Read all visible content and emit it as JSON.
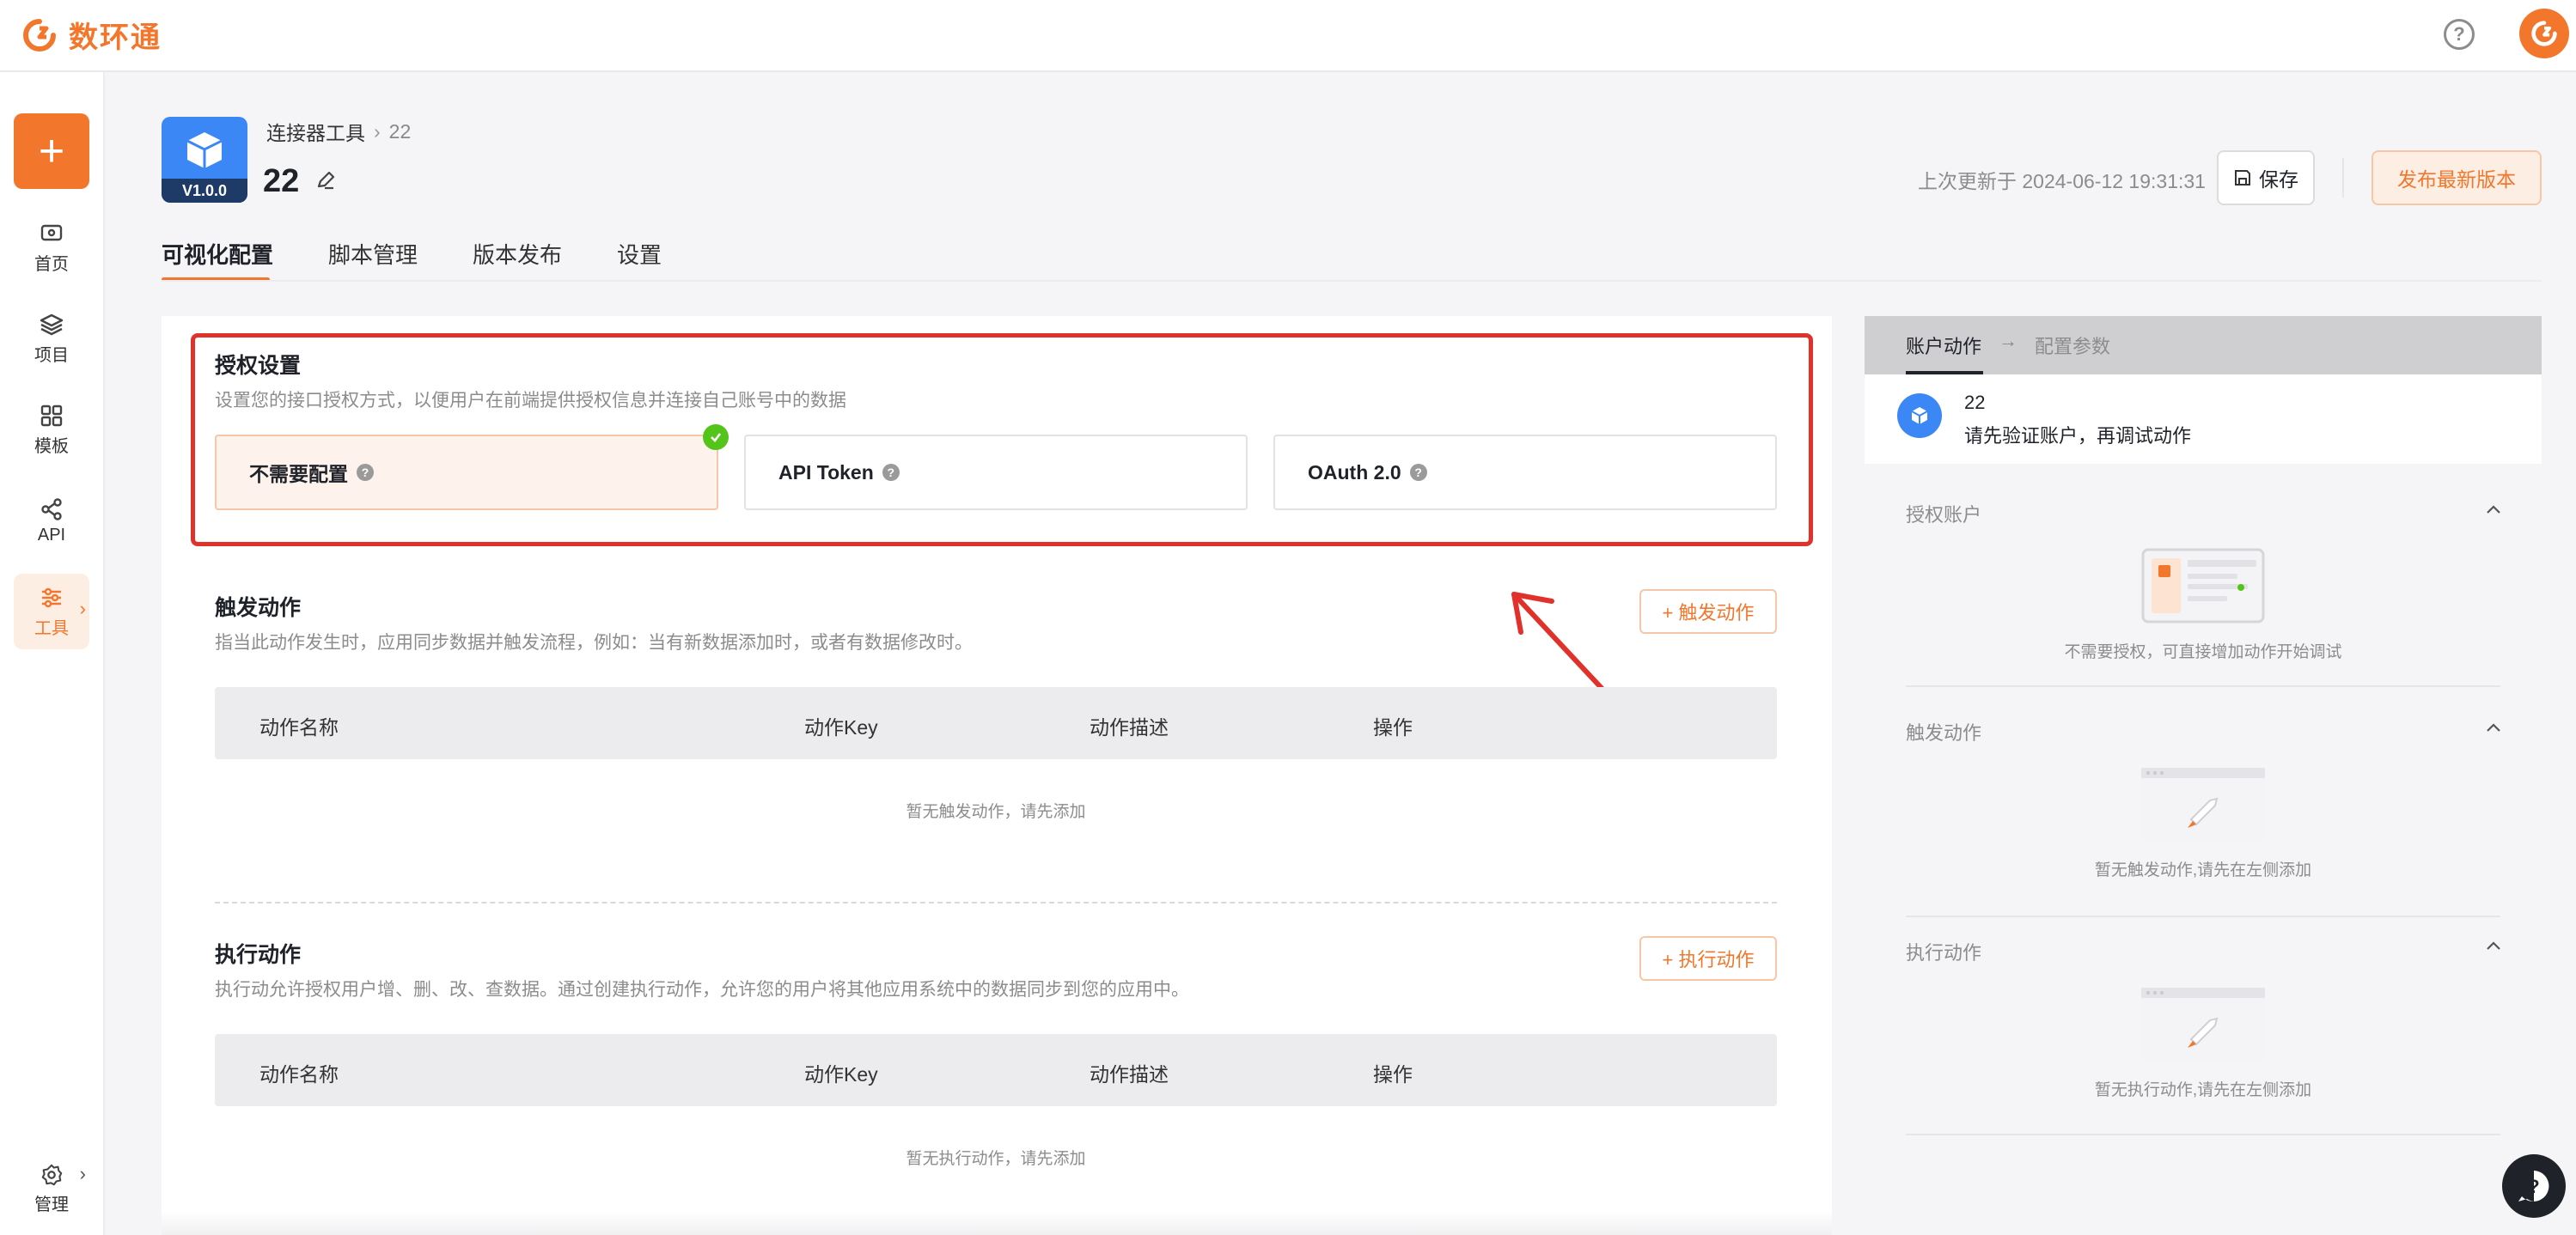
{
  "brand": {
    "name": "数环通",
    "accent": "#f2772c"
  },
  "leftnav": {
    "add_label": "+",
    "items": [
      {
        "label": "首页",
        "icon": "home-icon"
      },
      {
        "label": "项目",
        "icon": "layers-icon"
      },
      {
        "label": "模板",
        "icon": "grid-icon"
      },
      {
        "label": "API",
        "icon": "api-icon"
      },
      {
        "label": "工具",
        "icon": "tools-icon",
        "active": true
      }
    ],
    "manage_label": "管理"
  },
  "header": {
    "version": "V1.0.0",
    "breadcrumb": [
      "连接器工具",
      "22"
    ],
    "title": "22",
    "updated": "上次更新于 2024-06-12 19:31:31",
    "save_label": "保存",
    "publish_label": "发布最新版本"
  },
  "tabs": [
    "可视化配置",
    "脚本管理",
    "版本发布",
    "设置"
  ],
  "auth": {
    "title": "授权设置",
    "desc": "设置您的接口授权方式，以便用户在前端提供授权信息并连接自己账号中的数据",
    "options": [
      "不需要配置",
      "API Token",
      "OAuth 2.0"
    ],
    "selected": 0
  },
  "trigger": {
    "title": "触发动作",
    "desc": "指当此动作发生时，应用同步数据并触发流程，例如：当有新数据添加时，或者有数据修改时。",
    "add_label": "+ 触发动作",
    "columns": [
      "动作名称",
      "动作Key",
      "动作描述",
      "操作"
    ],
    "empty": "暂无触发动作，请先添加"
  },
  "execute": {
    "title": "执行动作",
    "desc": "执行动允许授权用户增、删、改、查数据。通过创建执行动作，允许您的用户将其他应用系统中的数据同步到您的应用中。",
    "add_label": "+ 执行动作",
    "columns": [
      "动作名称",
      "动作Key",
      "动作描述",
      "操作"
    ],
    "empty": "暂无执行动作，请先添加"
  },
  "right": {
    "tab_active": "账户动作",
    "arrow": "→",
    "tab_next": "配置参数",
    "card_name": "22",
    "card_hint": "请先验证账户，再调试动作",
    "sections": [
      {
        "title": "授权账户",
        "text": "不需要授权，可直接增加动作开始调试"
      },
      {
        "title": "触发动作",
        "text": "暂无触发动作,请先在左侧添加"
      },
      {
        "title": "执行动作",
        "text": "暂无执行动作,请先在左侧添加"
      }
    ]
  }
}
